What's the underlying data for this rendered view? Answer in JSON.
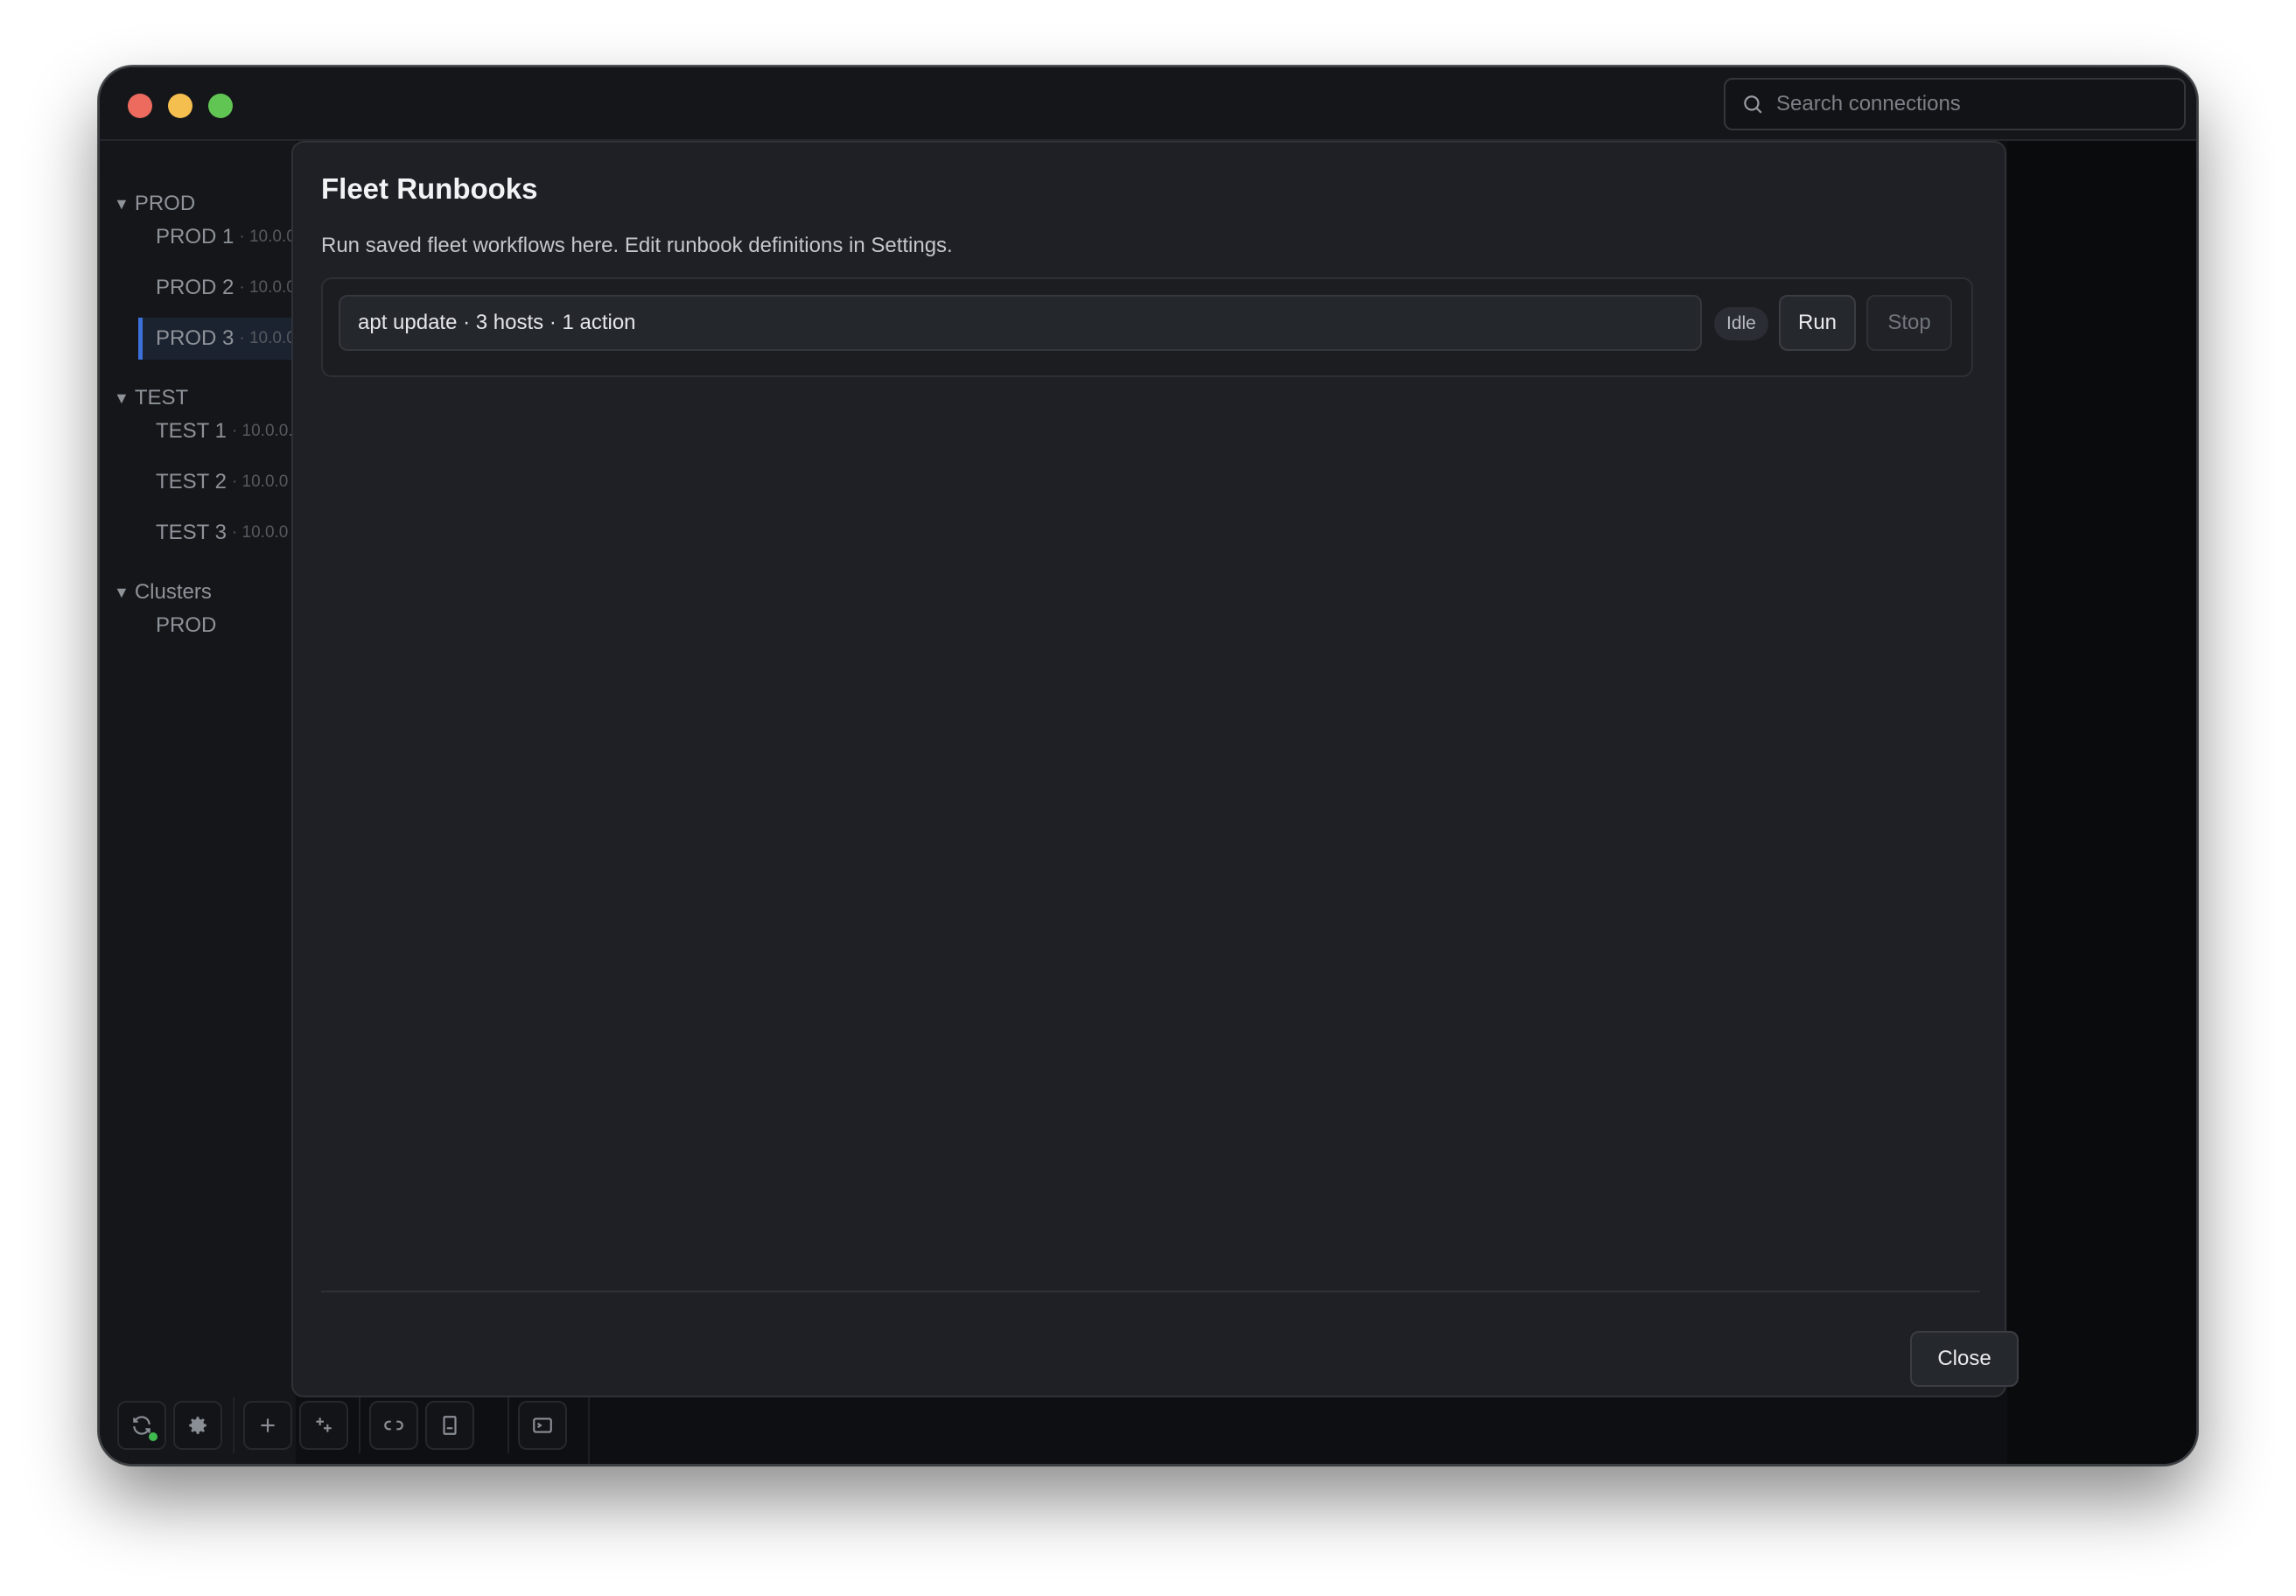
{
  "window": {
    "search_placeholder": "Search connections"
  },
  "sidebar": {
    "groups": [
      {
        "label": "PROD",
        "items": [
          {
            "label": "PROD 1",
            "ip": "· 10.0.0"
          },
          {
            "label": "PROD 2",
            "ip": "· 10.0.0"
          },
          {
            "label": "PROD 3",
            "ip": "· 10.0.0"
          }
        ]
      },
      {
        "label": "TEST",
        "items": [
          {
            "label": "TEST 1",
            "ip": "· 10.0.0."
          },
          {
            "label": "TEST 2",
            "ip": "· 10.0.0"
          },
          {
            "label": "TEST 3",
            "ip": "· 10.0.0"
          }
        ]
      },
      {
        "label": "Clusters",
        "items": [
          {
            "label": "PROD",
            "ip": ""
          }
        ]
      }
    ],
    "group_toggle_icon": "▼"
  },
  "modal": {
    "title": "Fleet Runbooks",
    "description": "Run saved fleet workflows here. Edit runbook definitions in Settings.",
    "runbook": {
      "summary": "apt update · 3 hosts · 1 action",
      "status": "Idle",
      "run_label": "Run",
      "stop_label": "Stop"
    },
    "close_label": "Close"
  },
  "colors": {
    "accent": "#3b6fd9",
    "status_online": "#3fb950"
  }
}
